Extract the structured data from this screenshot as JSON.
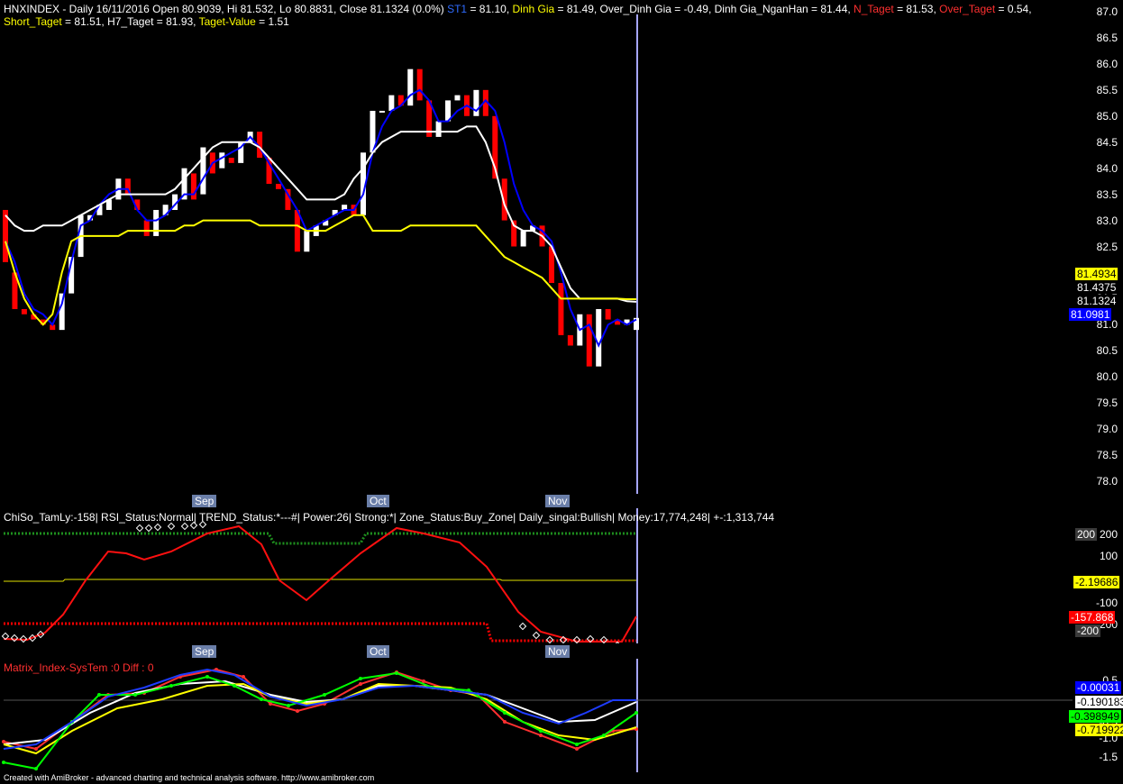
{
  "chart_header": {
    "line1_parts": [
      {
        "text": "HNXINDEX - Daily 16/11/2016 Open 80.9039, Hi 81.532, Lo 80.8831, Close 81.1324 (0.0%) ",
        "color": "#ffffff"
      },
      {
        "text": "ST1",
        "color": "#2e6bff"
      },
      {
        "text": " = 81.10, ",
        "color": "#ffffff"
      },
      {
        "text": "Dinh Gia",
        "color": "#ffff00"
      },
      {
        "text": " = 81.49, Over_Dinh Gia = -0.49, Dinh Gia_NganHan = 81.44, ",
        "color": "#ffffff"
      },
      {
        "text": "N_Taget",
        "color": "#ff3030"
      },
      {
        "text": " = 81.53, ",
        "color": "#ffffff"
      },
      {
        "text": "Over_Taget",
        "color": "#ff3030"
      },
      {
        "text": " = 0.54,",
        "color": "#ffffff"
      }
    ],
    "line2_parts": [
      {
        "text": "Short_Taget",
        "color": "#ffff00"
      },
      {
        "text": " = 81.51, H7_Taget = 81.93, ",
        "color": "#ffffff"
      },
      {
        "text": "Taget-Value",
        "color": "#ffff00"
      },
      {
        "text": " = 1.51",
        "color": "#ffffff"
      }
    ]
  },
  "price_axis": {
    "ticks": [
      "87.0",
      "86.5",
      "86.0",
      "85.5",
      "85.0",
      "84.5",
      "84.0",
      "83.5",
      "83.0",
      "82.5",
      "82.0",
      "81.5",
      "81.0",
      "80.5",
      "80.0",
      "79.5",
      "79.0",
      "78.5",
      "78.0"
    ],
    "tags": [
      {
        "text": "81.4934",
        "bg": "#ffff00",
        "fg": "#000000"
      },
      {
        "text": "81.4375",
        "bg": "#000000",
        "fg": "#ffffff"
      },
      {
        "text": "81.1324",
        "bg": "#000000",
        "fg": "#ffffff"
      },
      {
        "text": "81.0981",
        "bg": "#0000ff",
        "fg": "#ffffff"
      }
    ]
  },
  "months": [
    "Sep",
    "Oct",
    "Nov"
  ],
  "pane2": {
    "header": "ChiSo_TamLy:-158| RSI_Status:Normal| TREND_Status:*---#| Power:26| Strong:*| Zone_Status:Buy_Zone| Daily_singal:Bullish| Money:17,774,248| +-:1,313,744",
    "ticks": [
      "200",
      "100",
      "-100",
      "-200"
    ],
    "tags": [
      {
        "text": "200",
        "bg": "#3a3a3a",
        "fg": "#ffffff"
      },
      {
        "text": "-2.19686",
        "bg": "#ffff00",
        "fg": "#000000"
      },
      {
        "text": "-157.868",
        "bg": "#ff0000",
        "fg": "#ffffff"
      },
      {
        "text": "-200",
        "bg": "#3a3a3a",
        "fg": "#ffffff"
      }
    ]
  },
  "pane3": {
    "header": "Matrix_Index-SysTem :0  Diff : 0",
    "ticks": [
      "0.5",
      "-0.5",
      "-1.0",
      "-1.5"
    ],
    "tags": [
      {
        "text": "-0.00031",
        "bg": "#0000ff",
        "fg": "#ffffff"
      },
      {
        "text": "-0.190183",
        "bg": "#ffffff",
        "fg": "#000000"
      },
      {
        "text": "-0.398949",
        "bg": "#00ff00",
        "fg": "#000000"
      },
      {
        "text": "-0.719922",
        "bg": "#ffff00",
        "fg": "#000000"
      }
    ]
  },
  "footer": "Created with AmiBroker - advanced charting and technical analysis software. http://www.amibroker.com",
  "chart_data": {
    "type": "candlestick",
    "symbol": "HNXINDEX",
    "ylim": [
      78.0,
      87.0
    ],
    "candles": [
      {
        "o": 83.2,
        "c": 82.2,
        "h": 83.2,
        "l": 81.9
      },
      {
        "o": 82.0,
        "c": 81.3,
        "h": 82.1,
        "l": 81.2
      },
      {
        "o": 81.3,
        "c": 81.2,
        "h": 81.4,
        "l": 81.1
      },
      {
        "o": 81.2,
        "c": 81.1,
        "h": 81.3,
        "l": 81.0
      },
      {
        "o": 81.1,
        "c": 81.0,
        "h": 81.2,
        "l": 80.9
      },
      {
        "o": 81.0,
        "c": 80.9,
        "h": 81.1,
        "l": 80.8
      },
      {
        "o": 80.9,
        "c": 81.6,
        "h": 81.7,
        "l": 80.8
      },
      {
        "o": 81.6,
        "c": 82.3,
        "h": 82.4,
        "l": 81.5
      },
      {
        "o": 82.3,
        "c": 83.1,
        "h": 83.2,
        "l": 82.2
      },
      {
        "o": 83.0,
        "c": 83.1,
        "h": 83.2,
        "l": 82.9
      },
      {
        "o": 83.1,
        "c": 83.3,
        "h": 83.4,
        "l": 83.0
      },
      {
        "o": 83.2,
        "c": 83.4,
        "h": 83.5,
        "l": 83.1
      },
      {
        "o": 83.4,
        "c": 83.8,
        "h": 83.8,
        "l": 83.3
      },
      {
        "o": 83.8,
        "c": 83.5,
        "h": 83.8,
        "l": 83.3
      },
      {
        "o": 83.4,
        "c": 83.2,
        "h": 83.5,
        "l": 82.9
      },
      {
        "o": 83.0,
        "c": 82.7,
        "h": 83.2,
        "l": 82.6
      },
      {
        "o": 82.7,
        "c": 83.2,
        "h": 83.3,
        "l": 82.6
      },
      {
        "o": 83.1,
        "c": 83.3,
        "h": 83.4,
        "l": 83.0
      },
      {
        "o": 83.2,
        "c": 83.5,
        "h": 83.6,
        "l": 83.1
      },
      {
        "o": 83.4,
        "c": 84.0,
        "h": 84.1,
        "l": 83.3
      },
      {
        "o": 83.9,
        "c": 83.4,
        "h": 84.0,
        "l": 83.3
      },
      {
        "o": 83.5,
        "c": 84.4,
        "h": 84.5,
        "l": 83.4
      },
      {
        "o": 84.3,
        "c": 83.9,
        "h": 84.4,
        "l": 83.8
      },
      {
        "o": 84.0,
        "c": 84.3,
        "h": 84.4,
        "l": 83.9
      },
      {
        "o": 84.2,
        "c": 84.1,
        "h": 84.3,
        "l": 84.0
      },
      {
        "o": 84.1,
        "c": 84.5,
        "h": 84.6,
        "l": 84.0
      },
      {
        "o": 84.5,
        "c": 84.7,
        "h": 84.7,
        "l": 84.4
      },
      {
        "o": 84.7,
        "c": 84.2,
        "h": 84.7,
        "l": 84.1
      },
      {
        "o": 84.2,
        "c": 83.7,
        "h": 84.3,
        "l": 83.6
      },
      {
        "o": 83.7,
        "c": 83.6,
        "h": 83.8,
        "l": 83.5
      },
      {
        "o": 83.6,
        "c": 83.2,
        "h": 83.7,
        "l": 83.1
      },
      {
        "o": 83.2,
        "c": 82.4,
        "h": 83.2,
        "l": 82.3
      },
      {
        "o": 82.4,
        "c": 82.8,
        "h": 82.9,
        "l": 82.3
      },
      {
        "o": 82.7,
        "c": 82.9,
        "h": 83.0,
        "l": 82.6
      },
      {
        "o": 82.9,
        "c": 83.0,
        "h": 83.1,
        "l": 82.8
      },
      {
        "o": 83.1,
        "c": 83.2,
        "h": 83.3,
        "l": 83.0
      },
      {
        "o": 83.2,
        "c": 83.3,
        "h": 83.4,
        "l": 83.1
      },
      {
        "o": 83.3,
        "c": 83.1,
        "h": 83.3,
        "l": 83.0
      },
      {
        "o": 83.1,
        "c": 84.3,
        "h": 84.4,
        "l": 83.0
      },
      {
        "o": 84.3,
        "c": 85.1,
        "h": 85.2,
        "l": 84.2
      },
      {
        "o": 85.1,
        "c": 85.1,
        "h": 85.2,
        "l": 85.0
      },
      {
        "o": 85.1,
        "c": 85.4,
        "h": 85.5,
        "l": 85.0
      },
      {
        "o": 85.4,
        "c": 85.2,
        "h": 85.5,
        "l": 85.1
      },
      {
        "o": 85.2,
        "c": 85.9,
        "h": 85.9,
        "l": 85.1
      },
      {
        "o": 85.9,
        "c": 85.3,
        "h": 85.9,
        "l": 85.2
      },
      {
        "o": 85.3,
        "c": 84.6,
        "h": 85.3,
        "l": 84.5
      },
      {
        "o": 84.6,
        "c": 84.9,
        "h": 85.0,
        "l": 84.5
      },
      {
        "o": 84.9,
        "c": 85.3,
        "h": 85.4,
        "l": 84.8
      },
      {
        "o": 85.3,
        "c": 85.4,
        "h": 85.5,
        "l": 85.2
      },
      {
        "o": 85.4,
        "c": 85.0,
        "h": 85.5,
        "l": 84.9
      },
      {
        "o": 85.0,
        "c": 85.5,
        "h": 85.6,
        "l": 84.9
      },
      {
        "o": 85.5,
        "c": 85.0,
        "h": 85.5,
        "l": 84.9
      },
      {
        "o": 85.0,
        "c": 83.8,
        "h": 85.0,
        "l": 83.7
      },
      {
        "o": 83.8,
        "c": 83.0,
        "h": 83.9,
        "l": 82.9
      },
      {
        "o": 83.0,
        "c": 82.5,
        "h": 83.1,
        "l": 82.4
      },
      {
        "o": 82.5,
        "c": 82.8,
        "h": 82.9,
        "l": 82.4
      },
      {
        "o": 82.8,
        "c": 82.9,
        "h": 83.0,
        "l": 82.7
      },
      {
        "o": 82.9,
        "c": 82.5,
        "h": 83.0,
        "l": 82.4
      },
      {
        "o": 82.5,
        "c": 81.8,
        "h": 82.5,
        "l": 81.7
      },
      {
        "o": 81.8,
        "c": 80.8,
        "h": 81.8,
        "l": 80.7
      },
      {
        "o": 80.8,
        "c": 80.6,
        "h": 80.9,
        "l": 80.5
      },
      {
        "o": 80.6,
        "c": 81.2,
        "h": 81.2,
        "l": 80.5
      },
      {
        "o": 81.2,
        "c": 80.2,
        "h": 81.3,
        "l": 80.1
      },
      {
        "o": 80.2,
        "c": 81.3,
        "h": 81.4,
        "l": 80.1
      },
      {
        "o": 81.3,
        "c": 81.1,
        "h": 81.3,
        "l": 81.0
      },
      {
        "o": 81.1,
        "c": 81.0,
        "h": 81.2,
        "l": 80.9
      },
      {
        "o": 81.0,
        "c": 81.1,
        "h": 81.2,
        "l": 80.9
      },
      {
        "o": 80.9,
        "c": 81.13,
        "h": 81.53,
        "l": 80.88
      }
    ],
    "series": [
      {
        "name": "ST1",
        "color": "#0000ff",
        "values": [
          82.6,
          82.2,
          81.6,
          81.3,
          81.2,
          81.0,
          81.4,
          82.2,
          82.9,
          83.0,
          83.3,
          83.5,
          83.6,
          83.6,
          83.2,
          83.0,
          83.0,
          83.1,
          83.3,
          83.5,
          83.5,
          83.8,
          84.1,
          84.2,
          84.3,
          84.4,
          84.6,
          84.4,
          84.1,
          83.8,
          83.5,
          83.2,
          82.8,
          82.9,
          83.0,
          83.1,
          83.2,
          83.2,
          83.5,
          84.3,
          84.8,
          85.1,
          85.2,
          85.4,
          85.5,
          85.3,
          84.9,
          84.9,
          85.1,
          85.2,
          85.1,
          85.3,
          85.1,
          84.5,
          83.7,
          83.2,
          82.9,
          82.8,
          82.6,
          82.0,
          81.3,
          80.9,
          81.0,
          80.6,
          81.0,
          81.1,
          81.0,
          81.1
        ]
      },
      {
        "name": "",
        "color": "#ffffff",
        "values": [
          83.1,
          82.9,
          82.8,
          82.8,
          82.9,
          82.9,
          82.9,
          83.0,
          83.1,
          83.2,
          83.3,
          83.4,
          83.5,
          83.5,
          83.5,
          83.5,
          83.5,
          83.5,
          83.6,
          83.8,
          84.0,
          84.2,
          84.4,
          84.5,
          84.5,
          84.5,
          84.5,
          84.4,
          84.2,
          84.0,
          83.8,
          83.6,
          83.4,
          83.4,
          83.4,
          83.4,
          83.5,
          83.8,
          84.0,
          84.3,
          84.5,
          84.6,
          84.7,
          84.7,
          84.7,
          84.7,
          84.7,
          84.7,
          84.7,
          84.8,
          84.8,
          84.5,
          84.0,
          83.3,
          82.9,
          82.8,
          82.8,
          82.7,
          82.5,
          82.1,
          81.7,
          81.5,
          81.5,
          81.5,
          81.5,
          81.5,
          81.45,
          81.44
        ]
      },
      {
        "name": "Dinh Gia",
        "color": "#ffff00",
        "values": [
          82.6,
          82.0,
          81.5,
          81.2,
          81.0,
          81.2,
          82.0,
          82.6,
          82.7,
          82.7,
          82.7,
          82.7,
          82.7,
          82.8,
          82.8,
          82.8,
          82.8,
          82.8,
          82.8,
          82.9,
          82.9,
          83.0,
          83.0,
          83.0,
          83.0,
          83.0,
          83.0,
          82.9,
          82.9,
          82.9,
          82.9,
          82.9,
          82.8,
          82.8,
          82.8,
          82.9,
          83.0,
          83.1,
          83.1,
          82.8,
          82.8,
          82.8,
          82.8,
          82.9,
          82.9,
          82.9,
          82.9,
          82.9,
          82.9,
          82.9,
          82.9,
          82.7,
          82.5,
          82.3,
          82.2,
          82.1,
          82.0,
          81.9,
          81.7,
          81.5,
          81.5,
          81.5,
          81.5,
          81.5,
          81.5,
          81.5,
          81.49,
          81.49
        ]
      }
    ]
  }
}
